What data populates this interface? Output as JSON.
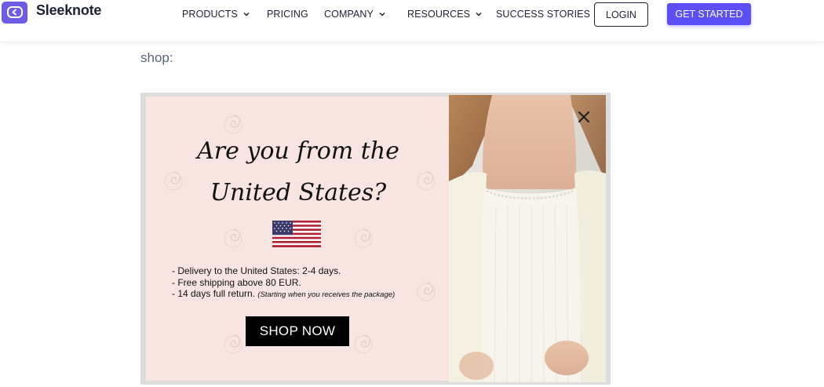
{
  "header": {
    "logo_text": "Sleeknote",
    "nav": [
      {
        "label": "PRODUCTS",
        "has_dropdown": true
      },
      {
        "label": "PRICING",
        "has_dropdown": false
      },
      {
        "label": "COMPANY",
        "has_dropdown": true
      },
      {
        "label": "RESOURCES",
        "has_dropdown": true
      },
      {
        "label": "SUCCESS STORIES",
        "has_dropdown": false
      }
    ],
    "login_label": "LOGIN",
    "cta_label": "GET STARTED"
  },
  "article": {
    "intro_text": "shop:"
  },
  "popup": {
    "headline_line1": "Are you from the",
    "headline_line2": "United States?",
    "bullets": [
      "- Delivery to the United States: 2-4 days.",
      "- Free shipping above 80 EUR.",
      "- 14 days full return."
    ],
    "bullet_note": "(Starting when you receives the package)",
    "button_label": "SHOP NOW"
  },
  "colors": {
    "brand": "#5b4ff5",
    "popup_bg": "#f8e4e1"
  },
  "icons": [
    "sleeknote-logo-icon",
    "chevron-down-icon",
    "us-flag-icon",
    "close-icon"
  ]
}
